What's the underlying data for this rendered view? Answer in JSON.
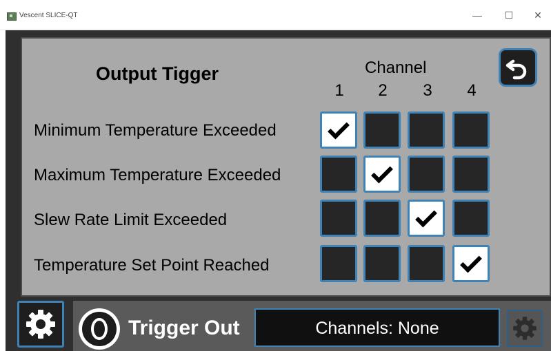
{
  "window": {
    "title": "Vescent SLICE-QT",
    "minimize_icon": "minimize-icon",
    "maximize_icon": "maximize-icon",
    "close_icon": "close-icon"
  },
  "panel": {
    "heading": "Output Tigger",
    "channel_heading": "Channel",
    "channels": [
      "1",
      "2",
      "3",
      "4"
    ],
    "rows": [
      {
        "label": "Minimum Temperature Exceeded",
        "checked": [
          true,
          false,
          false,
          false
        ]
      },
      {
        "label": "Maximum Temperature Exceeded",
        "checked": [
          false,
          true,
          false,
          false
        ]
      },
      {
        "label": "Slew Rate Limit Exceeded",
        "checked": [
          false,
          false,
          true,
          false
        ]
      },
      {
        "label": "Temperature Set Point Reached",
        "checked": [
          false,
          false,
          false,
          true
        ]
      }
    ],
    "back_icon": "back-arrow-icon"
  },
  "footer": {
    "trigger_label": "Trigger Out",
    "trigger_icon": "trigger-out-icon",
    "channels_status": "Channels: None",
    "left_icon": "gear-icon",
    "right_icon": "gear-icon"
  },
  "colors": {
    "accent": "#3f82b6",
    "panel_bg": "#a9a9a9",
    "frame_bg": "#2f2f2f",
    "cell_off": "#262626",
    "cell_on": "#ffffff"
  }
}
